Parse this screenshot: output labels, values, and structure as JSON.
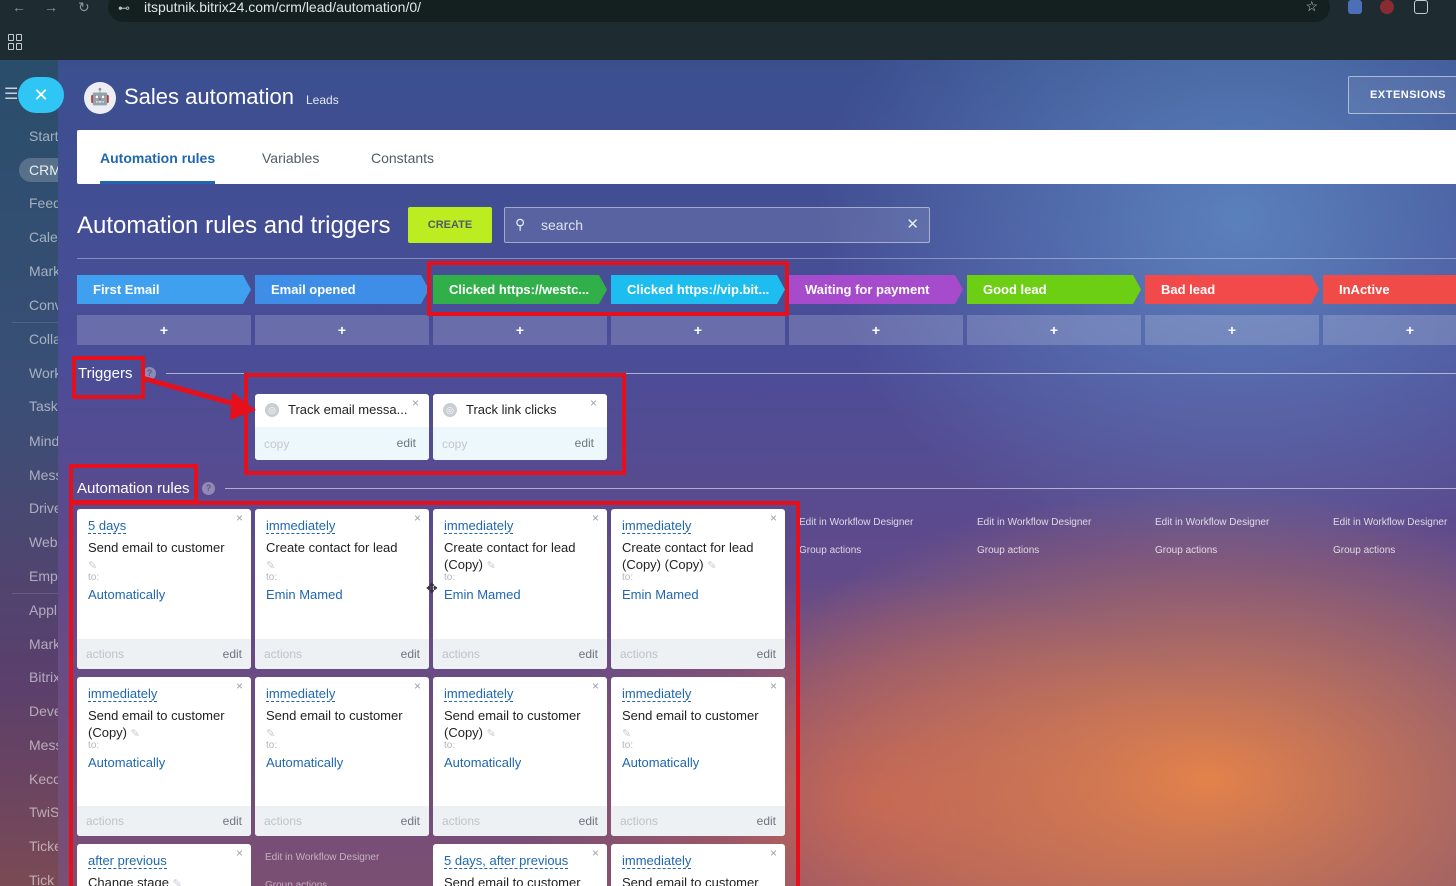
{
  "browser": {
    "url": "itsputnik.bitrix24.com/crm/lead/automation/0/",
    "back_icon": "←",
    "forward_icon": "→",
    "reload_icon": "↻",
    "site_icon": "⊷",
    "star_icon": "☆"
  },
  "sidebar": {
    "hamburger": "☰",
    "close_icon": "✕",
    "items": [
      "Start",
      "CRM",
      "Feed",
      "Cale",
      "Mark",
      "Conv",
      "Colla",
      "Work",
      "Task",
      "Mind",
      "Mess",
      "Drive",
      "Web",
      "Emp",
      "Appl",
      "Mark",
      "Bitrix",
      "Deve",
      "Mess",
      "Keco",
      "TwiS",
      "Ticke",
      "Tick"
    ]
  },
  "header": {
    "icon": "🤖",
    "title": "Sales automation",
    "subtitle": "Leads",
    "extensions_label": "EXTENSIONS"
  },
  "tabs": [
    {
      "label": "Automation rules"
    },
    {
      "label": "Variables"
    },
    {
      "label": "Constants"
    }
  ],
  "toolbar": {
    "title": "Automation rules and triggers",
    "create_label": "CREATE",
    "search_placeholder": "search",
    "search_icon": "⚲",
    "clear_icon": "✕"
  },
  "stages": [
    {
      "label": "First Email",
      "color": "#3fa0f0"
    },
    {
      "label": "Email opened",
      "color": "#3e8ee8"
    },
    {
      "label": "Clicked https://westc...",
      "color": "#31b04a"
    },
    {
      "label": "Clicked https://vip.bit...",
      "color": "#1dbdf0"
    },
    {
      "label": "Waiting for payment",
      "color": "#a54bcc"
    },
    {
      "label": "Good lead",
      "color": "#6ccf13"
    },
    {
      "label": "Bad lead",
      "color": "#f24a4a"
    },
    {
      "label": "InActive",
      "color": "#f04b46"
    }
  ],
  "add_symbol": "+",
  "triggers_section": {
    "title": "Triggers",
    "help": "?",
    "items": [
      {
        "name": "Track email messa...",
        "copy": "copy",
        "edit": "edit"
      },
      {
        "name": "Track link clicks",
        "copy": "copy",
        "edit": "edit"
      }
    ]
  },
  "rules_section": {
    "title": "Automation rules",
    "help": "?",
    "to_label": "to:",
    "actions_label": "actions",
    "edit_label": "edit",
    "close_icon": "×",
    "pencil_icon": "✎",
    "row1": [
      {
        "when": "5 days",
        "title": "Send email to customer",
        "who": "Automatically"
      },
      {
        "when": "immediately",
        "title": "Create contact for lead",
        "who": "Emin Mamed"
      },
      {
        "when": "immediately",
        "title": "Create contact for lead (Copy)",
        "who": "Emin Mamed"
      },
      {
        "when": "immediately",
        "title": "Create contact for lead (Copy) (Copy)",
        "who": "Emin Mamed"
      }
    ],
    "row2": [
      {
        "when": "immediately",
        "title": "Send email to customer (Copy)",
        "who": "Automatically"
      },
      {
        "when": "immediately",
        "title": "Send email to customer",
        "who": "Automatically"
      },
      {
        "when": "immediately",
        "title": "Send email to customer (Copy)",
        "who": "Automatically"
      },
      {
        "when": "immediately",
        "title": "Send email to customer",
        "who": "Automatically"
      }
    ],
    "row3": [
      {
        "when": "after previous",
        "title": "Change stage"
      },
      {
        "when": "5 days, after previous",
        "title": "Send email to customer"
      },
      {
        "when": "immediately",
        "title": "Send email to customer"
      }
    ],
    "workflow_links": {
      "edit": "Edit in Workflow Designer",
      "group": "Group actions"
    }
  },
  "highlight_color": "#e5101b"
}
